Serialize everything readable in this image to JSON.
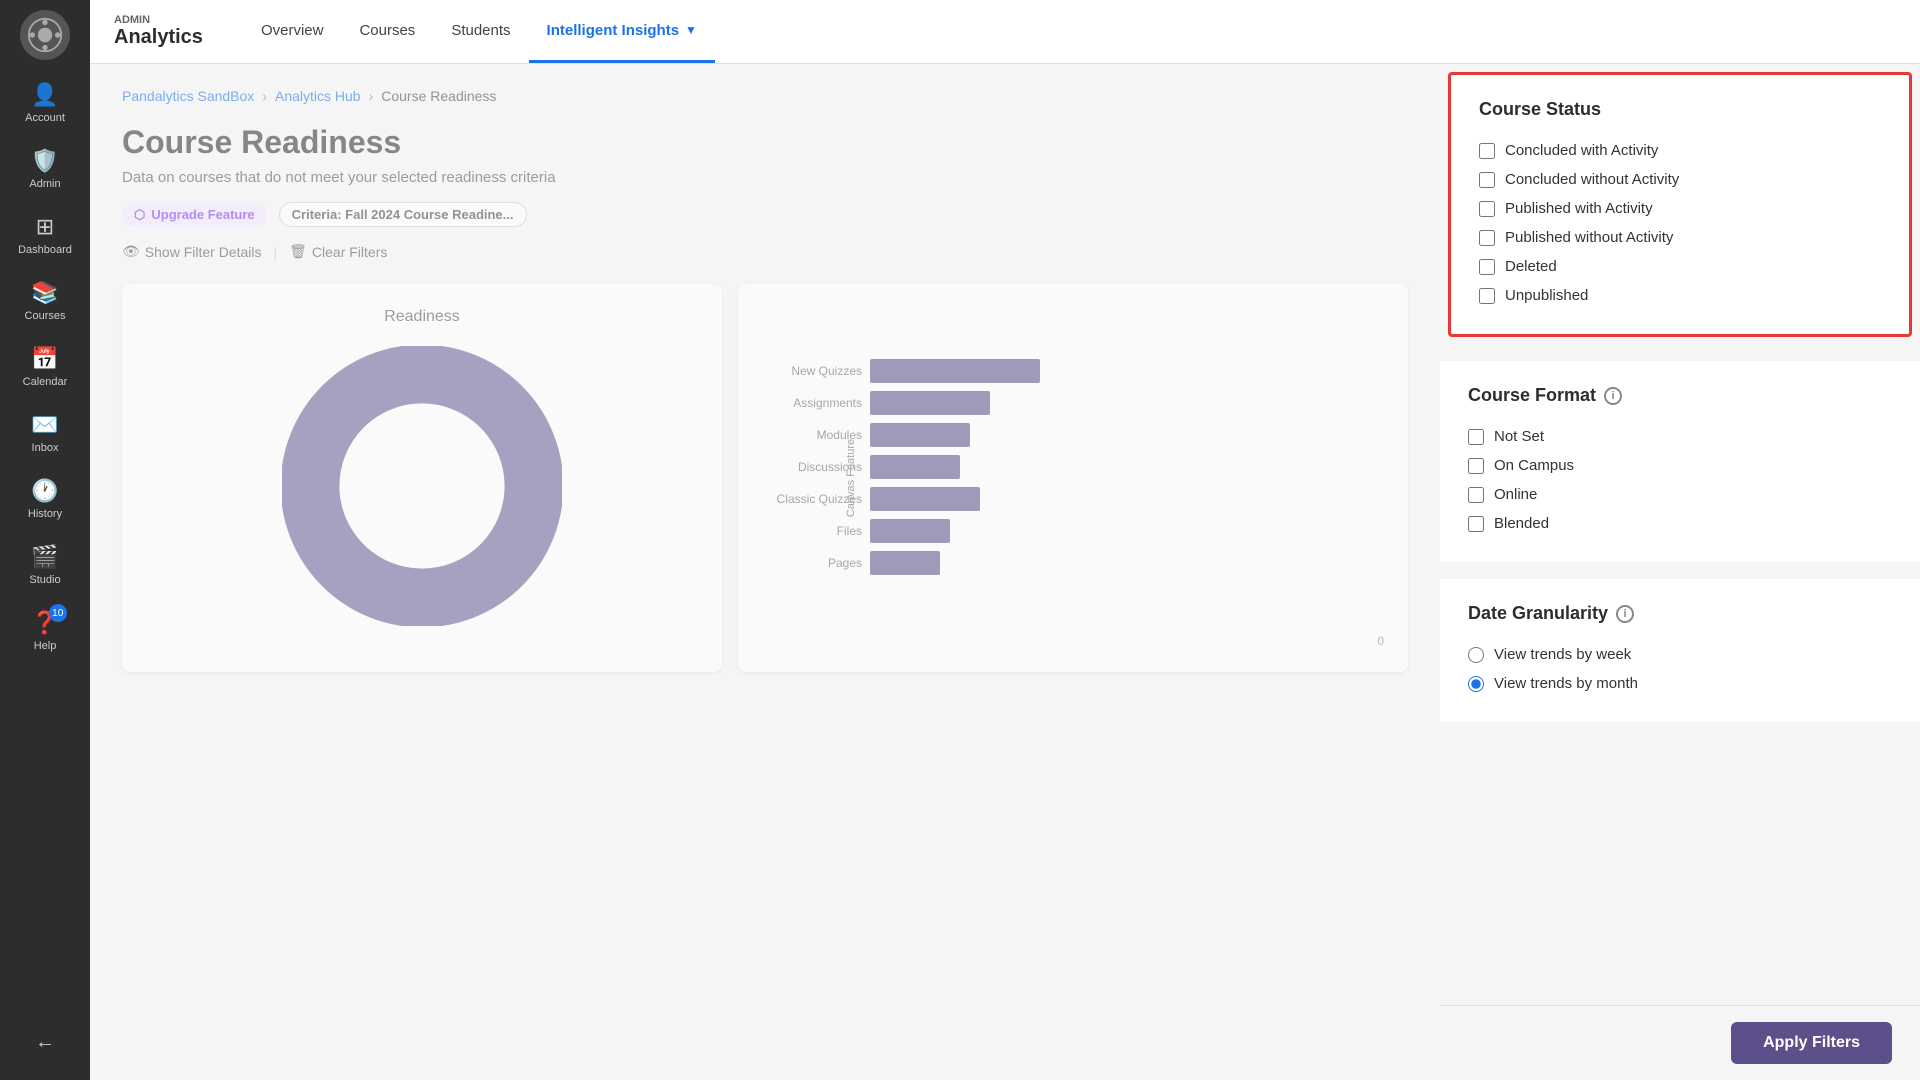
{
  "sidebar": {
    "logo_alt": "Canvas Logo",
    "items": [
      {
        "id": "account",
        "label": "Account",
        "icon": "👤"
      },
      {
        "id": "admin",
        "label": "Admin",
        "icon": "🛡️"
      },
      {
        "id": "dashboard",
        "label": "Dashboard",
        "icon": "📊"
      },
      {
        "id": "courses",
        "label": "Courses",
        "icon": "📚"
      },
      {
        "id": "calendar",
        "label": "Calendar",
        "icon": "📅"
      },
      {
        "id": "inbox",
        "label": "Inbox",
        "icon": "✉️"
      },
      {
        "id": "history",
        "label": "History",
        "icon": "🕐"
      },
      {
        "id": "studio",
        "label": "Studio",
        "icon": "🎬"
      },
      {
        "id": "help",
        "label": "Help",
        "icon": "❓",
        "badge": "10"
      }
    ],
    "collapse_label": "Collapse"
  },
  "topnav": {
    "admin_label": "ADMIN",
    "app_name": "Analytics",
    "links": [
      {
        "id": "overview",
        "label": "Overview",
        "active": false
      },
      {
        "id": "courses",
        "label": "Courses",
        "active": false
      },
      {
        "id": "students",
        "label": "Students",
        "active": false
      },
      {
        "id": "intelligent-insights",
        "label": "Intelligent Insights",
        "active": true,
        "has_chevron": true
      }
    ]
  },
  "breadcrumb": {
    "items": [
      {
        "label": "Pandalytics SandBox",
        "link": true
      },
      {
        "label": "Analytics Hub",
        "link": true
      },
      {
        "label": "Course Readiness",
        "link": false
      }
    ]
  },
  "page": {
    "title": "Course Readiness",
    "subtitle": "Data on courses that do not meet your selected readiness criteria",
    "upgrade_badge": "Upgrade Feature",
    "criteria_label": "Criteria:",
    "criteria_value": "Fall 2024 Course Readine...",
    "show_filter_label": "Show Filter Details",
    "clear_filter_label": "Clear Filters"
  },
  "charts": {
    "readiness": {
      "title": "Readiness",
      "donut_color": "#6b5b95",
      "donut_center_color": "#fff"
    },
    "canvas_feature": {
      "title": "Canvas Feature",
      "y_axis_label": "Canvas Feature",
      "bars": [
        {
          "label": "New Quizzes",
          "value": 85
        },
        {
          "label": "Assignments",
          "value": 60
        },
        {
          "label": "Modules",
          "value": 50
        },
        {
          "label": "Discussions",
          "value": 45
        },
        {
          "label": "Classic Quizzes",
          "value": 55
        },
        {
          "label": "Files",
          "value": 40
        },
        {
          "label": "Pages",
          "value": 35
        }
      ],
      "x_max": 0,
      "bar_color": "#5c4f8a"
    }
  },
  "filter_panel": {
    "course_status": {
      "title": "Course Status",
      "highlighted": true,
      "options": [
        {
          "id": "concluded-with-activity",
          "label": "Concluded with Activity",
          "checked": false
        },
        {
          "id": "concluded-without-activity",
          "label": "Concluded without Activity",
          "checked": false
        },
        {
          "id": "published-with-activity",
          "label": "Published with Activity",
          "checked": false
        },
        {
          "id": "published-without-activity",
          "label": "Published without Activity",
          "checked": false
        },
        {
          "id": "deleted",
          "label": "Deleted",
          "checked": false
        },
        {
          "id": "unpublished",
          "label": "Unpublished",
          "checked": false
        }
      ]
    },
    "course_format": {
      "title": "Course Format",
      "has_info": true,
      "options": [
        {
          "id": "not-set",
          "label": "Not Set",
          "checked": false
        },
        {
          "id": "on-campus",
          "label": "On Campus",
          "checked": false
        },
        {
          "id": "online",
          "label": "Online",
          "checked": false
        },
        {
          "id": "blended",
          "label": "Blended",
          "checked": false
        }
      ]
    },
    "date_granularity": {
      "title": "Date Granularity",
      "has_info": true,
      "options": [
        {
          "id": "view-by-week",
          "label": "View trends by week",
          "selected": false,
          "type": "radio"
        },
        {
          "id": "view-by-month",
          "label": "View trends by month",
          "selected": true,
          "type": "radio"
        }
      ]
    },
    "apply_button_label": "Apply Filters"
  }
}
